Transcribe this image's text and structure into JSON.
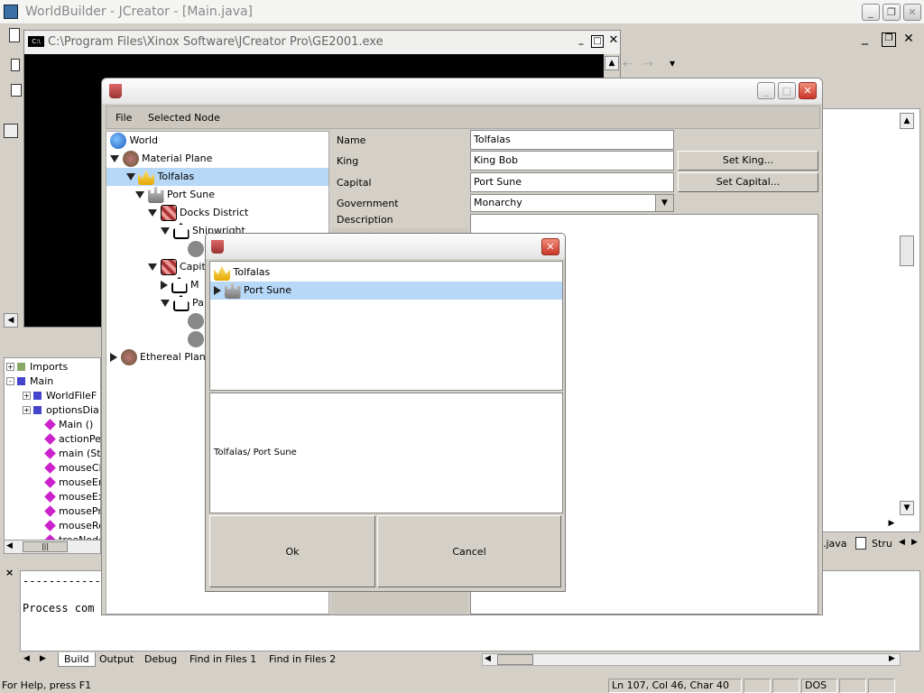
{
  "ide": {
    "title": "WorldBuilder - JCreator - [Main.java]",
    "tree_items": [
      {
        "label": "Imports"
      },
      {
        "label": "Main"
      },
      {
        "label": "WorldFileF"
      },
      {
        "label": "optionsDia"
      },
      {
        "label": "Main ()"
      },
      {
        "label": "actionPerf"
      },
      {
        "label": "main (Strir"
      },
      {
        "label": "mouseClick"
      },
      {
        "label": "mouseEnte"
      },
      {
        "label": "mouseExit"
      },
      {
        "label": "mousePres"
      },
      {
        "label": "mouseRele"
      },
      {
        "label": "treeNodes"
      }
    ],
    "editor_tabs": [
      ".java",
      "Stru"
    ],
    "output_lines": [
      "--------------",
      "Process com"
    ],
    "bottom_tabs": [
      "Build",
      "Output",
      "Debug",
      "Find in Files 1",
      "Find in Files 2"
    ],
    "status": {
      "help": "For Help, press F1",
      "position": "Ln 107, Col 46, Char 40",
      "mode": "DOS"
    }
  },
  "console": {
    "title": "C:\\Program Files\\Xinox Software\\JCreator Pro\\GE2001.exe",
    "icon": "C:\\"
  },
  "app": {
    "menu": [
      "File",
      "Selected Node"
    ],
    "tree": [
      {
        "label": "World",
        "icon": "globe-icon"
      },
      {
        "label": "Material Plane",
        "icon": "plane-icon"
      },
      {
        "label": "Tolfalas",
        "icon": "crown-icon"
      },
      {
        "label": "Port Sune",
        "icon": "castle-icon"
      },
      {
        "label": "Docks District",
        "icon": "district-icon"
      },
      {
        "label": "Shipwright",
        "icon": "house-icon"
      },
      {
        "label": "Capit",
        "icon": "district-icon"
      },
      {
        "label": "M",
        "icon": "house-icon"
      },
      {
        "label": "Pa",
        "icon": "house-icon"
      },
      {
        "label": "Ethereal Plane",
        "icon": "plane-icon"
      }
    ],
    "props": {
      "name_label": "Name",
      "name_value": "Tolfalas",
      "king_label": "King",
      "king_value": "King Bob",
      "king_btn": "Set King...",
      "capital_label": "Capital",
      "capital_value": "Port Sune",
      "capital_btn": "Set Capital...",
      "gov_label": "Government",
      "gov_value": "Monarchy",
      "desc_label": "Description"
    }
  },
  "dialog": {
    "tree": [
      {
        "label": "Tolfalas",
        "icon": "crown-icon"
      },
      {
        "label": "Port Sune",
        "icon": "castle-icon"
      }
    ],
    "path": "Tolfalas/ Port Sune",
    "ok": "Ok",
    "cancel": "Cancel"
  }
}
